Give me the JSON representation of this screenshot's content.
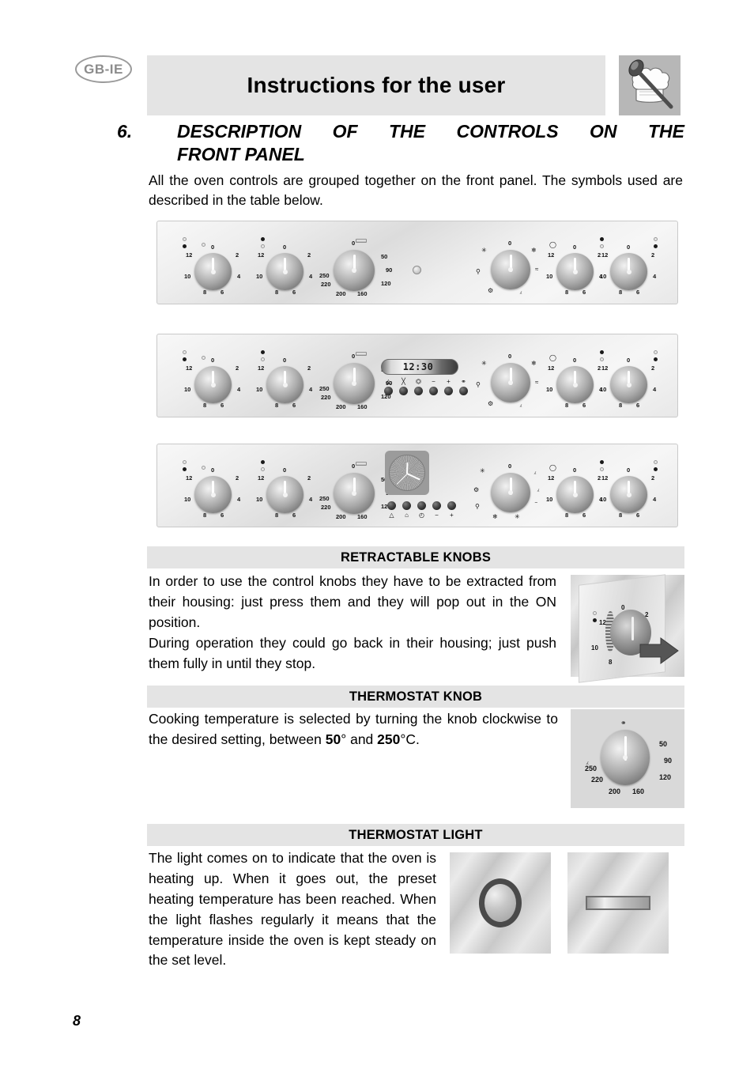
{
  "header": {
    "lang_badge": "GB-IE",
    "title": "Instructions for the user",
    "chef_icon": "chef-hat-spoon-icon"
  },
  "section": {
    "number": "6.",
    "title_line1": "DESCRIPTION OF THE CONTROLS ON THE",
    "title_line2": "FRONT PANEL",
    "intro": "All the oven controls are grouped together on the front panel. The symbols used are described in the table below."
  },
  "panels": {
    "knob_timer_labels": [
      "0",
      "2",
      "4",
      "6",
      "8",
      "10",
      "12"
    ],
    "thermostat_labels": [
      "0",
      "50",
      "90",
      "120",
      "160",
      "200",
      "220",
      "250"
    ],
    "function_center_label": "0",
    "lcd_value": "12:30",
    "lcd_buttons": [
      "bell-icon",
      "pot-crossed-icon",
      "pan-icon",
      "minus-icon",
      "plus-icon",
      "lamp-icon"
    ],
    "clock_buttons": [
      "bell-icon",
      "pan-icon",
      "clock-icon",
      "minus-icon",
      "plus-icon"
    ],
    "clock_button_symbols": [
      "△",
      "⌂",
      "◴",
      "−",
      "+"
    ]
  },
  "sections": [
    {
      "heading": "RETRACTABLE KNOBS",
      "paragraphs": [
        "In order to use the control knobs they have to be extracted from their housing: just press them and they will pop out in the ON position.",
        "During operation they could go back in their housing; just push them fully in until they stop."
      ],
      "figure": "retractable-knob-figure"
    },
    {
      "heading": "THERMOSTAT KNOB",
      "paragraphs": [
        "Cooking temperature is selected by turning the knob clockwise to the desired setting, between 50° and 250°C."
      ],
      "bold_min": "50",
      "bold_max": "250",
      "figure": "thermostat-knob-figure"
    },
    {
      "heading": "THERMOSTAT LIGHT",
      "paragraphs": [
        "The light comes on to indicate that the oven is heating up. When it goes out, the preset heating temperature has been reached. When the light flashes regularly it means that the temperature inside the oven is kept steady on the set level."
      ],
      "figure_round": "thermostat-light-round-figure",
      "figure_bar": "thermostat-light-bar-figure"
    }
  ],
  "footer": {
    "page_number": "8"
  },
  "colors": {
    "band_gray": "#e4e4e4",
    "badge_gray": "#8c8c8c",
    "chef_bg": "#b7b7b7"
  }
}
